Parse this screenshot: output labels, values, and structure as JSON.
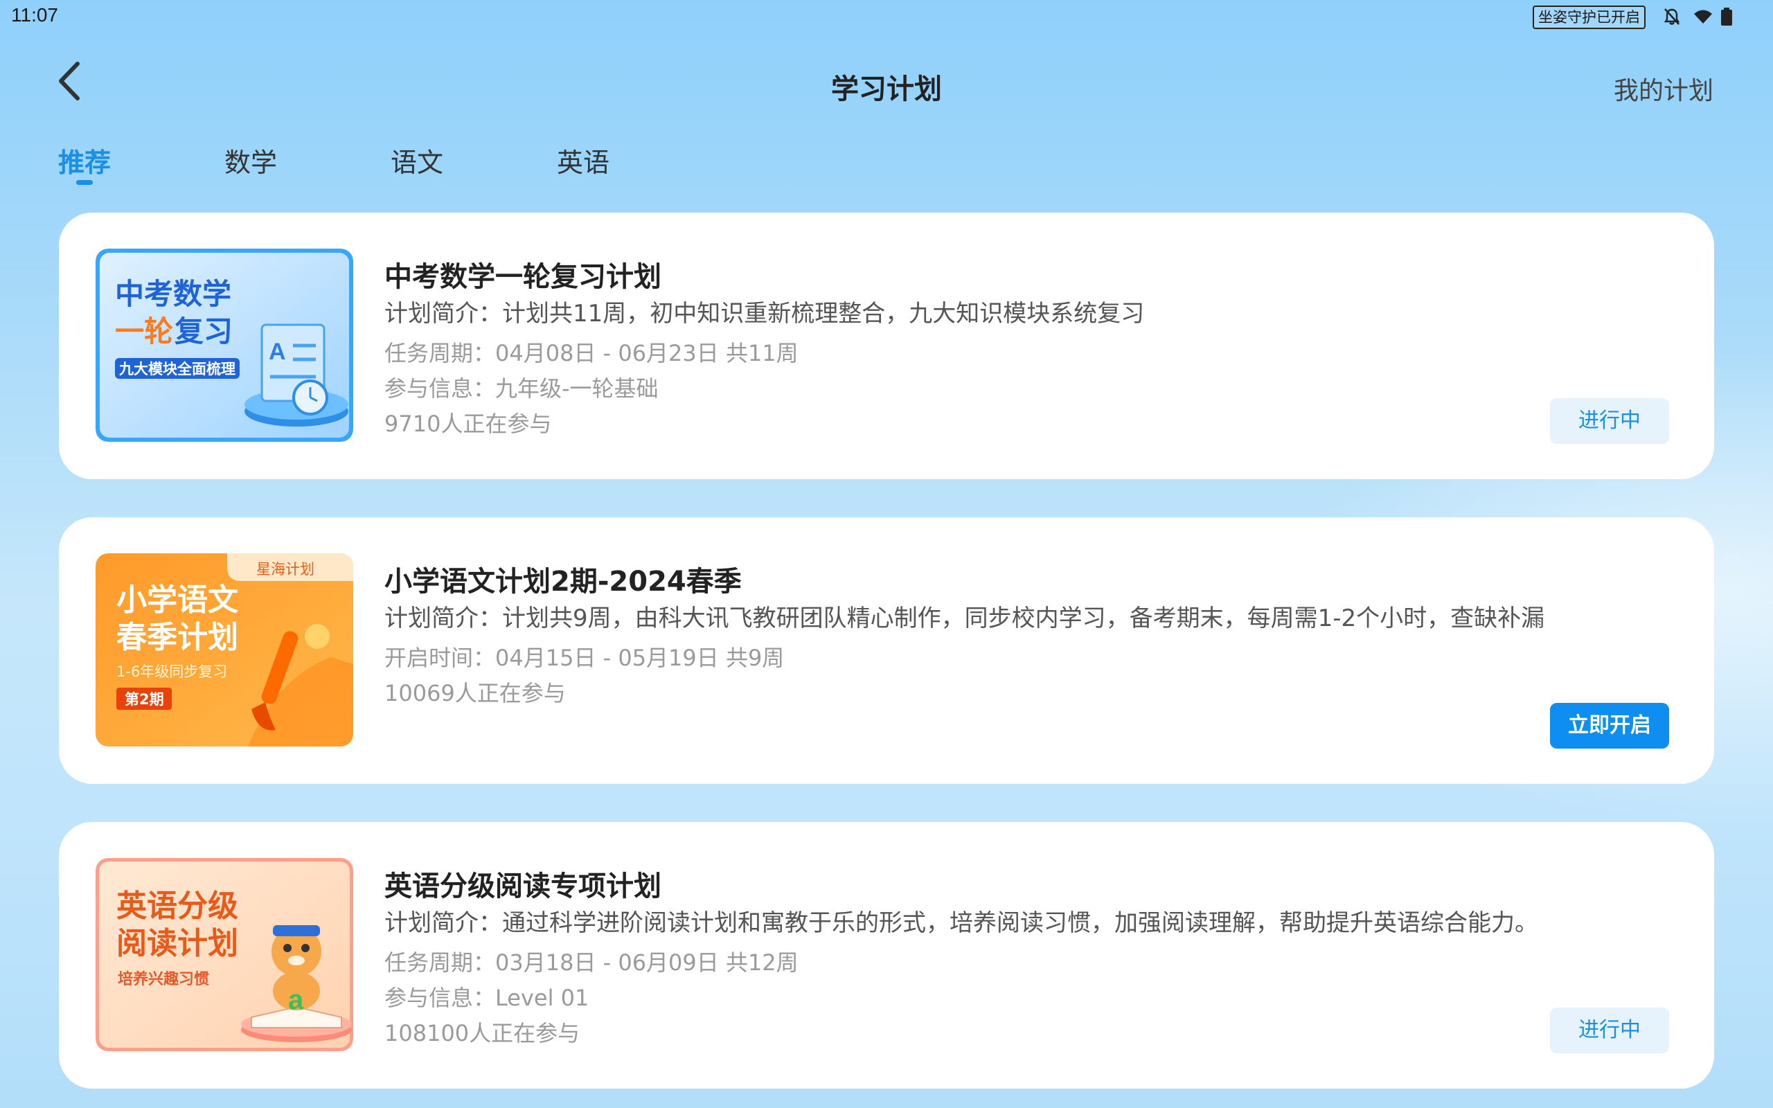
{
  "status_bar": {
    "time": "11:07",
    "posture_badge": "坐姿守护已开启",
    "icons": [
      "bell-off-icon",
      "wifi-icon",
      "battery-icon"
    ]
  },
  "header": {
    "back_icon": "chevron-left-icon",
    "title": "学习计划",
    "my_plan": "我的计划"
  },
  "tabs": [
    {
      "label": "推荐",
      "active": true
    },
    {
      "label": "数学",
      "active": false
    },
    {
      "label": "语文",
      "active": false
    },
    {
      "label": "英语",
      "active": false
    }
  ],
  "plans": [
    {
      "title": "中考数学一轮复习计划",
      "desc": "计划简介：计划共11周，初中知识重新梳理整合，九大知识模块系统复习",
      "period": "任务周期：04月08日 - 06月23日  共11周",
      "info": "参与信息：九年级-一轮基础",
      "participants": "9710人正在参与",
      "button": "进行中",
      "thumb": {
        "line1": "中考数学",
        "line2a": "一轮",
        "line2b": "复习",
        "tagline": "九大模块全面梳理"
      }
    },
    {
      "title": "小学语文计划2期-2024春季",
      "desc": "计划简介：计划共9周，由科大讯飞教研团队精心制作，同步校内学习，备考期末，每周需1-2个小时，查缺补漏",
      "period": "开启时间：04月15日 - 05月19日  共9周",
      "participants": "10069人正在参与",
      "button": "立即开启",
      "thumb": {
        "corner": "星海计划",
        "line1": "小学语文",
        "line2": "春季计划",
        "tagline": "1-6年级同步复习",
        "badge": "第2期"
      }
    },
    {
      "title": "英语分级阅读专项计划",
      "desc": "计划简介：通过科学进阶阅读计划和寓教于乐的形式，培养阅读习惯，加强阅读理解，帮助提升英语综合能力。",
      "period": "任务周期：03月18日 - 06月09日  共12周",
      "info": "参与信息：Level 01",
      "participants": "108100人正在参与",
      "button": "进行中",
      "thumb": {
        "line1": "英语分级",
        "line2": "阅读计划",
        "tagline": "培养兴趣习惯"
      }
    }
  ],
  "colors": {
    "accent": "#1a8fe6",
    "start_button": "#0d8ef0",
    "ongoing_button_bg": "#e6f3fc"
  }
}
